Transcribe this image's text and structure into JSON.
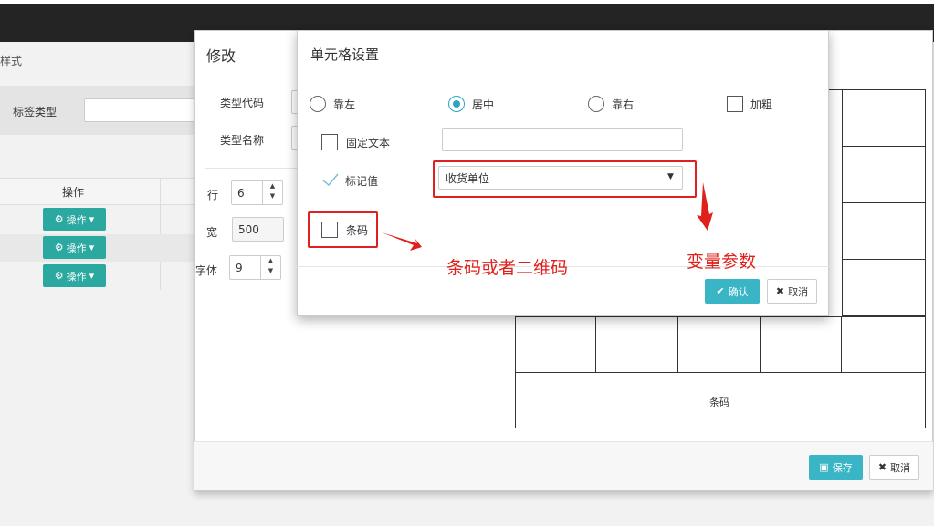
{
  "background_page": {
    "title": "样式",
    "search_label": "标签类型",
    "table_header": "操作",
    "row_action_label": "操作"
  },
  "edit_modal": {
    "title": "修改",
    "type_code_label": "类型代码",
    "type_name_label": "类型名称",
    "rows_label": "行",
    "rows_value": "6",
    "width_label": "宽",
    "width_value": "500",
    "font_label": "字体",
    "font_value": "9",
    "grid_barcode_label": "条码",
    "save_label": "保存",
    "cancel_label": "取消"
  },
  "cell_dialog": {
    "title": "单元格设置",
    "align_left": "靠左",
    "align_center": "居中",
    "align_right": "靠右",
    "bold": "加粗",
    "fixed_text": "固定文本",
    "marker_value": "标记值",
    "selected_variable": "收货单位",
    "barcode": "条码",
    "ok_label": "确认",
    "cancel_label": "取消",
    "selected_alignment": "居中"
  },
  "annotations": {
    "barcode_note": "条码或者二维码",
    "variable_note": "变量参数"
  },
  "colors": {
    "accent": "#3ab5c6",
    "action_button": "#2ba8a0",
    "annotation_red": "#e0201a",
    "topbar": "#242424"
  }
}
